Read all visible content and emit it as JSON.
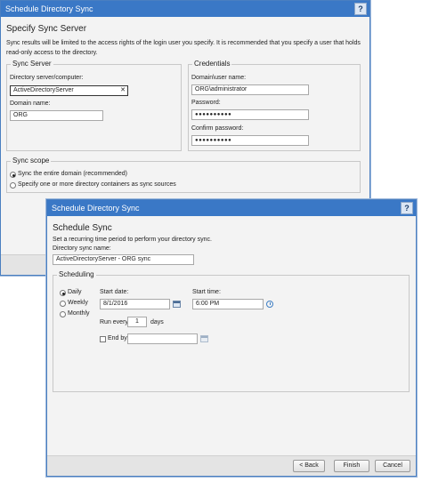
{
  "back_window": {
    "title": "Schedule Directory Sync",
    "help": "?",
    "heading": "Specify Sync Server",
    "description": "Sync results will be limited to the access rights of the login user you specify. It is recommended that you specify a user that holds read-only access to the directory.",
    "sync_server": {
      "legend": "Sync Server",
      "directory_label": "Directory server/computer:",
      "directory_value": "ActiveDirectoryServer",
      "clear_glyph": "✕",
      "domain_label": "Domain name:",
      "domain_value": "ORG"
    },
    "credentials": {
      "legend": "Credentials",
      "user_label": "Domain\\user name:",
      "user_value": "ORG\\administrator",
      "password_label": "Password:",
      "password_value": "●●●●●●●●●●",
      "confirm_label": "Confirm password:",
      "confirm_value": "●●●●●●●●●●"
    },
    "sync_scope": {
      "legend": "Sync scope",
      "option_entire": "Sync the entire domain (recommended)",
      "option_containers": "Specify one or more directory containers as sync sources",
      "selected": "entire"
    }
  },
  "front_window": {
    "title": "Schedule Directory Sync",
    "help": "?",
    "heading": "Schedule Sync",
    "description": "Set a recurring time period to perform your directory sync.",
    "name_label": "Directory sync name:",
    "name_value": "ActiveDirectoryServer - ORG sync",
    "scheduling": {
      "legend": "Scheduling",
      "freq_daily": "Daily",
      "freq_weekly": "Weekly",
      "freq_monthly": "Monthly",
      "selected": "Daily",
      "start_date_label": "Start date:",
      "start_date_value": "8/1/2016",
      "start_time_label": "Start time:",
      "start_time_value": "6:00 PM",
      "run_every_prefix": "Run every",
      "run_every_value": "1",
      "run_every_suffix": "days",
      "end_by_label": "End by:",
      "end_by_value": "",
      "end_by_checked": false
    },
    "buttons": {
      "back": "< Back",
      "finish": "Finish",
      "cancel": "Cancel"
    }
  }
}
